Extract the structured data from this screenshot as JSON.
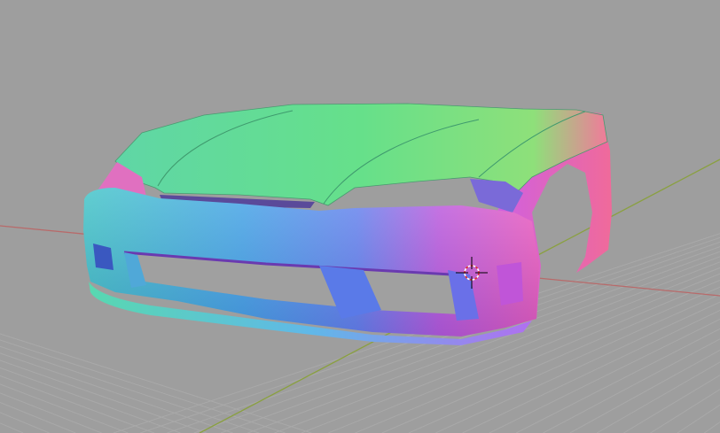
{
  "viewport": {
    "background_color": "#9e9e9e",
    "grid_color": "#a9a9a9",
    "x_axis_color": "#b86a6a",
    "y_axis_color": "#8aa040",
    "shading": "normal-map",
    "object": "car-front-bumper-hood"
  },
  "cursor": {
    "icon": "3d-cursor-icon",
    "ring_colors": [
      "#e03030",
      "#ffffff"
    ]
  }
}
